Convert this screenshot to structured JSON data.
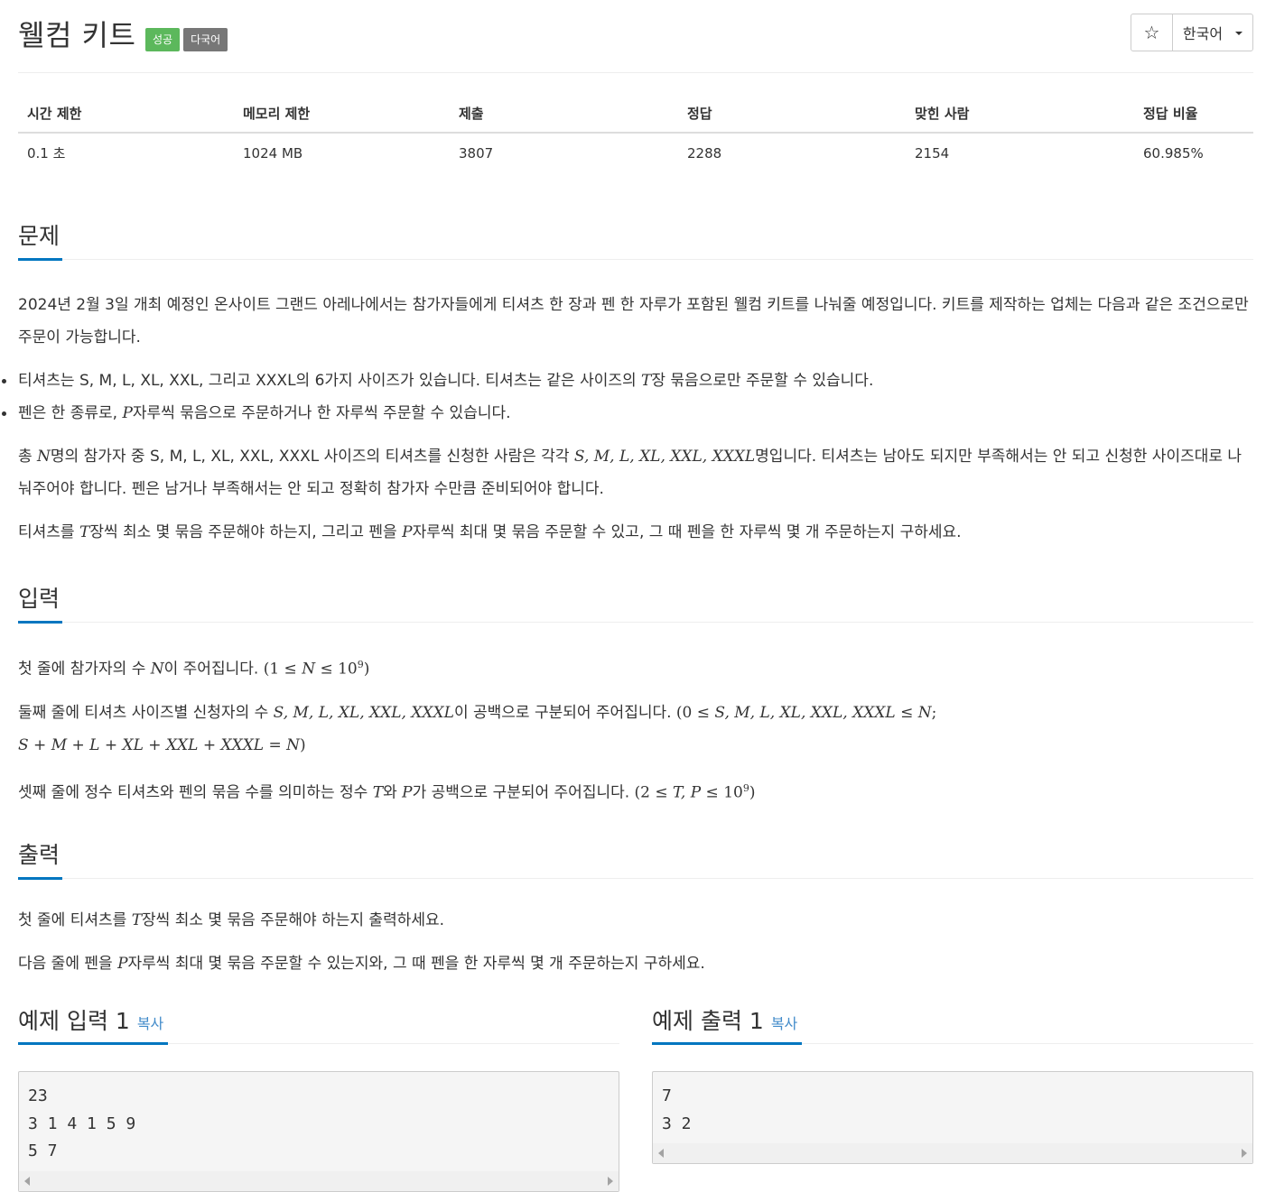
{
  "header": {
    "title": "웰컴 키트",
    "badges": [
      "성공",
      "다국어"
    ],
    "star_icon": "☆",
    "language": "한국어"
  },
  "stats": {
    "headers": [
      "시간 제한",
      "메모리 제한",
      "제출",
      "정답",
      "맞힌 사람",
      "정답 비율"
    ],
    "values": [
      "0.1 초",
      "1024 MB",
      "3807",
      "2288",
      "2154",
      "60.985%"
    ]
  },
  "problem": {
    "heading": "문제",
    "p1": "2024년 2월 3일 개최 예정인 온사이트 그랜드 아레나에서는 참가자들에게 티셔츠 한 장과 펜 한 자루가 포함된 웰컴 키트를 나눠줄 예정입니다. 키트를 제작하는 업체는 다음과 같은 조건으로만 주문이 가능합니다.",
    "li1_a": "티셔츠는 S, M, L, XL, XXL, 그리고 XXXL의 6가지 사이즈가 있습니다. 티셔츠는 같은 사이즈의 ",
    "li1_m": "T",
    "li1_b": "장 묶음으로만 주문할 수 있습니다.",
    "li2_a": "펜은 한 종류로, ",
    "li2_m": "P",
    "li2_b": "자루씩 묶음으로 주문하거나 한 자루씩 주문할 수 있습니다.",
    "p2_a": "총 ",
    "p2_m1": "N",
    "p2_b": "명의 참가자 중 S, M, L, XL, XXL, XXXL 사이즈의 티셔츠를 신청한 사람은 각각 ",
    "p2_m2": "S, M, L, XL, XXL, XXXL",
    "p2_c": "명입니다. 티셔츠는 남아도 되지만 부족해서는 안 되고 신청한 사이즈대로 나눠주어야 합니다. 펜은 남거나 부족해서는 안 되고 정확히 참가자 수만큼 준비되어야 합니다.",
    "p3_a": "티셔츠를 ",
    "p3_m1": "T",
    "p3_b": "장씩 최소 몇 묶음 주문해야 하는지, 그리고 펜을 ",
    "p3_m2": "P",
    "p3_c": "자루씩 최대 몇 묶음 주문할 수 있고, 그 때 펜을 한 자루씩 몇 개 주문하는지 구하세요."
  },
  "input": {
    "heading": "입력",
    "l1_a": "첫 줄에 참가자의 수 ",
    "l1_m": "N",
    "l1_b": "이 주어집니다. ",
    "l1_math_a": "(1 ≤ ",
    "l1_math_m": "N",
    "l1_math_b": " ≤ 10",
    "l1_sup": "9",
    "l1_close": ")",
    "l2_a": "둘째 줄에 티셔츠 사이즈별 신청자의 수 ",
    "l2_m": "S, M, L, XL, XXL, XXXL",
    "l2_b": "이 공백으로 구분되어 주어집니다. ",
    "l2_math_a": "(0 ≤ ",
    "l2_math_m": "S, M, L, XL, XXL, XXXL",
    "l2_math_b": " ≤ ",
    "l2_math_n": "N",
    "l2_math_c": ";",
    "l2_line2": "S + M + L + XL + XXL + XXXL = N",
    "l2_close": ")",
    "l3_a": "셋째 줄에 정수 티셔츠와 펜의 묶음 수를 의미하는 정수 ",
    "l3_m1": "T",
    "l3_b": "와 ",
    "l3_m2": "P",
    "l3_c": "가 공백으로 구분되어 주어집니다. ",
    "l3_math_a": "(2 ≤ ",
    "l3_math_m": "T, P",
    "l3_math_b": " ≤ 10",
    "l3_sup": "9",
    "l3_close": ")"
  },
  "output": {
    "heading": "출력",
    "l1_a": "첫 줄에 티셔츠를 ",
    "l1_m": "T",
    "l1_b": "장씩 최소 몇 묶음 주문해야 하는지 출력하세요.",
    "l2_a": "다음 줄에 펜을 ",
    "l2_m": "P",
    "l2_b": "자루씩 최대 몇 묶음 주문할 수 있는지와, 그 때 펜을 한 자루씩 몇 개 주문하는지 구하세요."
  },
  "examples": {
    "input_title": "예제 입력 1",
    "output_title": "예제 출력 1",
    "copy_label": "복사",
    "input_text": "23\n3 1 4 1 5 9\n5 7",
    "output_text": "7\n3 2"
  }
}
